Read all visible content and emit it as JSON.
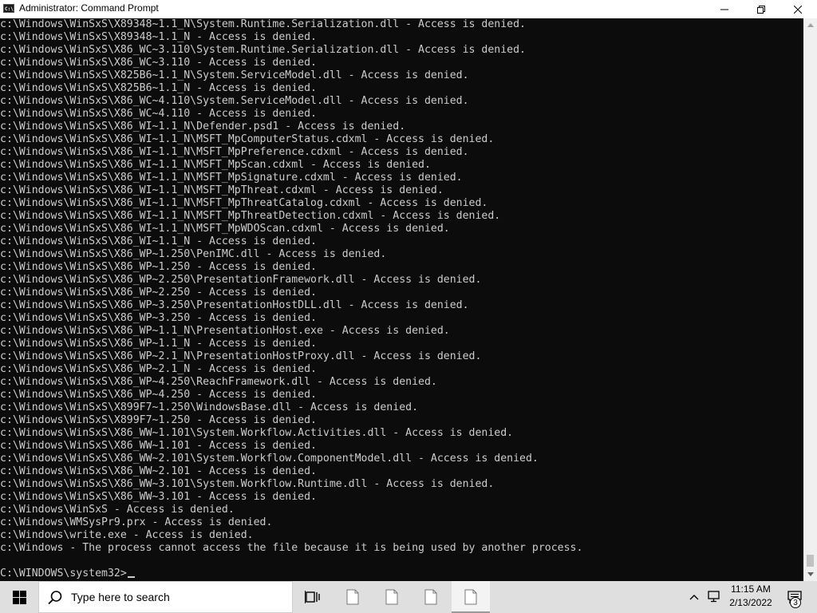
{
  "window": {
    "title": "Administrator: Command Prompt",
    "icon_name": "cmd-icon",
    "icon_label": "C:\\"
  },
  "console": {
    "lines": [
      "c:\\Windows\\WinSxS\\X89348~1.1_N\\System.Runtime.Serialization.dll - Access is denied.",
      "c:\\Windows\\WinSxS\\X89348~1.1_N - Access is denied.",
      "c:\\Windows\\WinSxS\\X86_WC~3.110\\System.Runtime.Serialization.dll - Access is denied.",
      "c:\\Windows\\WinSxS\\X86_WC~3.110 - Access is denied.",
      "c:\\Windows\\WinSxS\\X825B6~1.1_N\\System.ServiceModel.dll - Access is denied.",
      "c:\\Windows\\WinSxS\\X825B6~1.1_N - Access is denied.",
      "c:\\Windows\\WinSxS\\X86_WC~4.110\\System.ServiceModel.dll - Access is denied.",
      "c:\\Windows\\WinSxS\\X86_WC~4.110 - Access is denied.",
      "c:\\Windows\\WinSxS\\X86_WI~1.1_N\\Defender.psd1 - Access is denied.",
      "c:\\Windows\\WinSxS\\X86_WI~1.1_N\\MSFT_MpComputerStatus.cdxml - Access is denied.",
      "c:\\Windows\\WinSxS\\X86_WI~1.1_N\\MSFT_MpPreference.cdxml - Access is denied.",
      "c:\\Windows\\WinSxS\\X86_WI~1.1_N\\MSFT_MpScan.cdxml - Access is denied.",
      "c:\\Windows\\WinSxS\\X86_WI~1.1_N\\MSFT_MpSignature.cdxml - Access is denied.",
      "c:\\Windows\\WinSxS\\X86_WI~1.1_N\\MSFT_MpThreat.cdxml - Access is denied.",
      "c:\\Windows\\WinSxS\\X86_WI~1.1_N\\MSFT_MpThreatCatalog.cdxml - Access is denied.",
      "c:\\Windows\\WinSxS\\X86_WI~1.1_N\\MSFT_MpThreatDetection.cdxml - Access is denied.",
      "c:\\Windows\\WinSxS\\X86_WI~1.1_N\\MSFT_MpWDOScan.cdxml - Access is denied.",
      "c:\\Windows\\WinSxS\\X86_WI~1.1_N - Access is denied.",
      "c:\\Windows\\WinSxS\\X86_WP~1.250\\PenIMC.dll - Access is denied.",
      "c:\\Windows\\WinSxS\\X86_WP~1.250 - Access is denied.",
      "c:\\Windows\\WinSxS\\X86_WP~2.250\\PresentationFramework.dll - Access is denied.",
      "c:\\Windows\\WinSxS\\X86_WP~2.250 - Access is denied.",
      "c:\\Windows\\WinSxS\\X86_WP~3.250\\PresentationHostDLL.dll - Access is denied.",
      "c:\\Windows\\WinSxS\\X86_WP~3.250 - Access is denied.",
      "c:\\Windows\\WinSxS\\X86_WP~1.1_N\\PresentationHost.exe - Access is denied.",
      "c:\\Windows\\WinSxS\\X86_WP~1.1_N - Access is denied.",
      "c:\\Windows\\WinSxS\\X86_WP~2.1_N\\PresentationHostProxy.dll - Access is denied.",
      "c:\\Windows\\WinSxS\\X86_WP~2.1_N - Access is denied.",
      "c:\\Windows\\WinSxS\\X86_WP~4.250\\ReachFramework.dll - Access is denied.",
      "c:\\Windows\\WinSxS\\X86_WP~4.250 - Access is denied.",
      "c:\\Windows\\WinSxS\\X899F7~1.250\\WindowsBase.dll - Access is denied.",
      "c:\\Windows\\WinSxS\\X899F7~1.250 - Access is denied.",
      "c:\\Windows\\WinSxS\\X86_WW~1.101\\System.Workflow.Activities.dll - Access is denied.",
      "c:\\Windows\\WinSxS\\X86_WW~1.101 - Access is denied.",
      "c:\\Windows\\WinSxS\\X86_WW~2.101\\System.Workflow.ComponentModel.dll - Access is denied.",
      "c:\\Windows\\WinSxS\\X86_WW~2.101 - Access is denied.",
      "c:\\Windows\\WinSxS\\X86_WW~3.101\\System.Workflow.Runtime.dll - Access is denied.",
      "c:\\Windows\\WinSxS\\X86_WW~3.101 - Access is denied.",
      "c:\\Windows\\WinSxS - Access is denied.",
      "c:\\Windows\\WMSysPr9.prx - Access is denied.",
      "c:\\Windows\\write.exe - Access is denied.",
      "c:\\Windows - The process cannot access the file because it is being used by another process.",
      ""
    ],
    "prompt": "C:\\WINDOWS\\system32>"
  },
  "taskbar": {
    "search_placeholder": "Type here to search",
    "items": [
      {
        "icon": "task-view-icon",
        "active": false
      },
      {
        "icon": "file-icon",
        "active": false
      },
      {
        "icon": "file-icon",
        "active": false
      },
      {
        "icon": "file-icon",
        "active": false
      },
      {
        "icon": "file-icon",
        "active": true
      }
    ],
    "time": "11:15 AM",
    "date": "2/13/2022",
    "notification_count": "3"
  }
}
